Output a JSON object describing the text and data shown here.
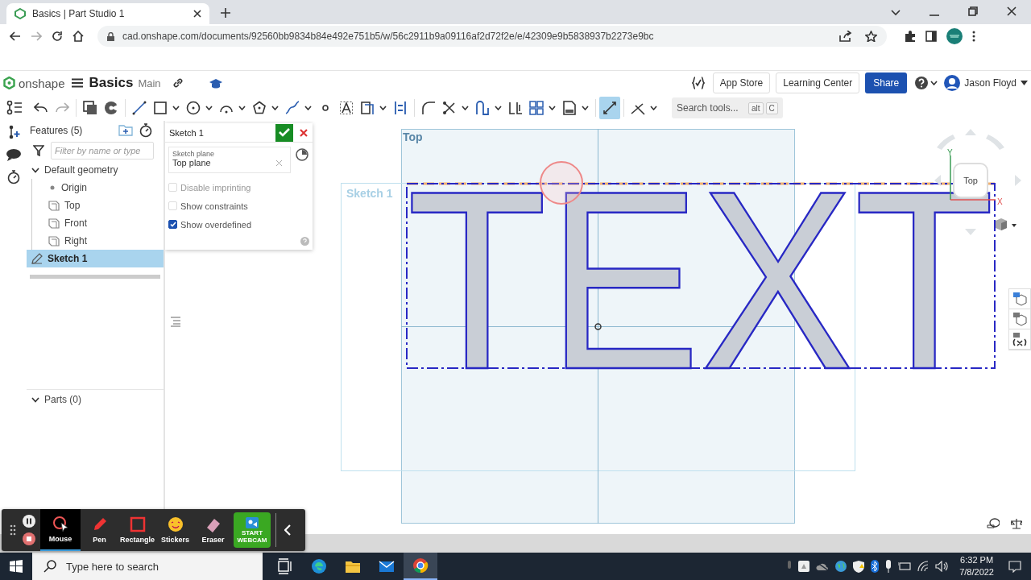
{
  "browser": {
    "tab_title": "Basics | Part Studio 1",
    "url": "cad.onshape.com/documents/92560bb9834b84e492e751b5/w/56c2911b9a09116af2d72f2e/e/42309e9b5838937b2273e9bc"
  },
  "app_header": {
    "logo": "onshape",
    "document": "Basics",
    "branch": "Main",
    "buttons": [
      {
        "label": "App Store",
        "kind": "plain"
      },
      {
        "label": "Learning Center",
        "kind": "plain"
      },
      {
        "label": "Share",
        "kind": "primary"
      }
    ],
    "user": "Jason Floyd"
  },
  "toolbar": {
    "tools": [
      {
        "kind": "undo",
        "dropdown": false,
        "selected": false
      },
      {
        "kind": "redo",
        "dropdown": false,
        "selected": false
      },
      {
        "kind": "separator"
      },
      {
        "kind": "pages",
        "dropdown": false,
        "selected": false
      },
      {
        "kind": "pie",
        "dropdown": false,
        "selected": false
      },
      {
        "kind": "separator"
      },
      {
        "kind": "line",
        "dropdown": false,
        "selected": false
      },
      {
        "kind": "rectangle",
        "dropdown": true,
        "selected": false
      },
      {
        "kind": "circle",
        "dropdown": true,
        "selected": false
      },
      {
        "kind": "arc",
        "dropdown": true,
        "selected": false
      },
      {
        "kind": "polygon",
        "dropdown": true,
        "selected": false
      },
      {
        "kind": "spline",
        "dropdown": true,
        "selected": false
      },
      {
        "kind": "point",
        "dropdown": false,
        "selected": false
      },
      {
        "kind": "frame",
        "dropdown": false,
        "selected": false
      },
      {
        "kind": "offset",
        "dropdown": true,
        "selected": false
      },
      {
        "kind": "align",
        "dropdown": false,
        "selected": false
      },
      {
        "kind": "separator"
      },
      {
        "kind": "fillet",
        "dropdown": false,
        "selected": false
      },
      {
        "kind": "scissors",
        "dropdown": true,
        "selected": false
      },
      {
        "kind": "hook",
        "dropdown": true,
        "selected": false
      },
      {
        "kind": "bracket",
        "dropdown": false,
        "selected": false
      },
      {
        "kind": "grid",
        "dropdown": true,
        "selected": false
      },
      {
        "kind": "document",
        "dropdown": true,
        "selected": false
      },
      {
        "kind": "separator"
      },
      {
        "kind": "diagonal",
        "dropdown": false,
        "selected": true
      },
      {
        "kind": "separator"
      },
      {
        "kind": "angle",
        "dropdown": true,
        "selected": false
      }
    ],
    "search": {
      "placeholder": "Search tools...",
      "keys": [
        "alt",
        "C"
      ]
    }
  },
  "features": {
    "title": "Features (5)",
    "filter_placeholder": "Filter by name or type",
    "tree": [
      {
        "label": "Default geometry",
        "kind": "group",
        "expanded": true,
        "selected": false,
        "children": [
          {
            "label": "Origin",
            "kind": "point",
            "selected": false
          },
          {
            "label": "Top",
            "kind": "plane",
            "selected": false
          },
          {
            "label": "Front",
            "kind": "plane",
            "selected": false
          },
          {
            "label": "Right",
            "kind": "plane",
            "selected": false
          }
        ]
      },
      {
        "label": "Sketch 1",
        "kind": "sketch",
        "selected": true
      }
    ],
    "parts": {
      "label": "Parts (0)",
      "expanded": true
    }
  },
  "sketch_dialog": {
    "title": "Sketch 1",
    "field_label": "Sketch plane",
    "field_value": "Top plane",
    "options": [
      {
        "label": "Disable imprinting",
        "checked": false,
        "disabled": true
      },
      {
        "label": "Show constraints",
        "checked": false,
        "disabled": false
      },
      {
        "label": "Show overdefined",
        "checked": true,
        "disabled": false
      }
    ]
  },
  "canvas": {
    "plane_labels": [
      "Top",
      "Sketch 1"
    ],
    "sketch_text": "TEXT",
    "view_cube": "Top",
    "axes": [
      "Y",
      "X"
    ]
  },
  "recorder": {
    "tools": [
      {
        "label": "Mouse",
        "kind": "mouse",
        "selected": true
      },
      {
        "label": "Pen",
        "kind": "pen",
        "selected": false
      },
      {
        "label": "Rectangle",
        "kind": "rectangle",
        "selected": false
      },
      {
        "label": "Stickers",
        "kind": "stickers",
        "selected": false
      },
      {
        "label": "Eraser",
        "kind": "eraser",
        "selected": false
      }
    ],
    "webcam": "START WEBCAM"
  },
  "taskbar": {
    "search_placeholder": "Type here to search",
    "apps": [
      {
        "kind": "taskview",
        "selected": false
      },
      {
        "kind": "edge",
        "selected": false
      },
      {
        "kind": "folder",
        "selected": false
      },
      {
        "kind": "mail",
        "selected": false
      },
      {
        "kind": "chrome",
        "selected": true
      }
    ],
    "time": "6:32 PM",
    "date": "7/8/2022"
  }
}
